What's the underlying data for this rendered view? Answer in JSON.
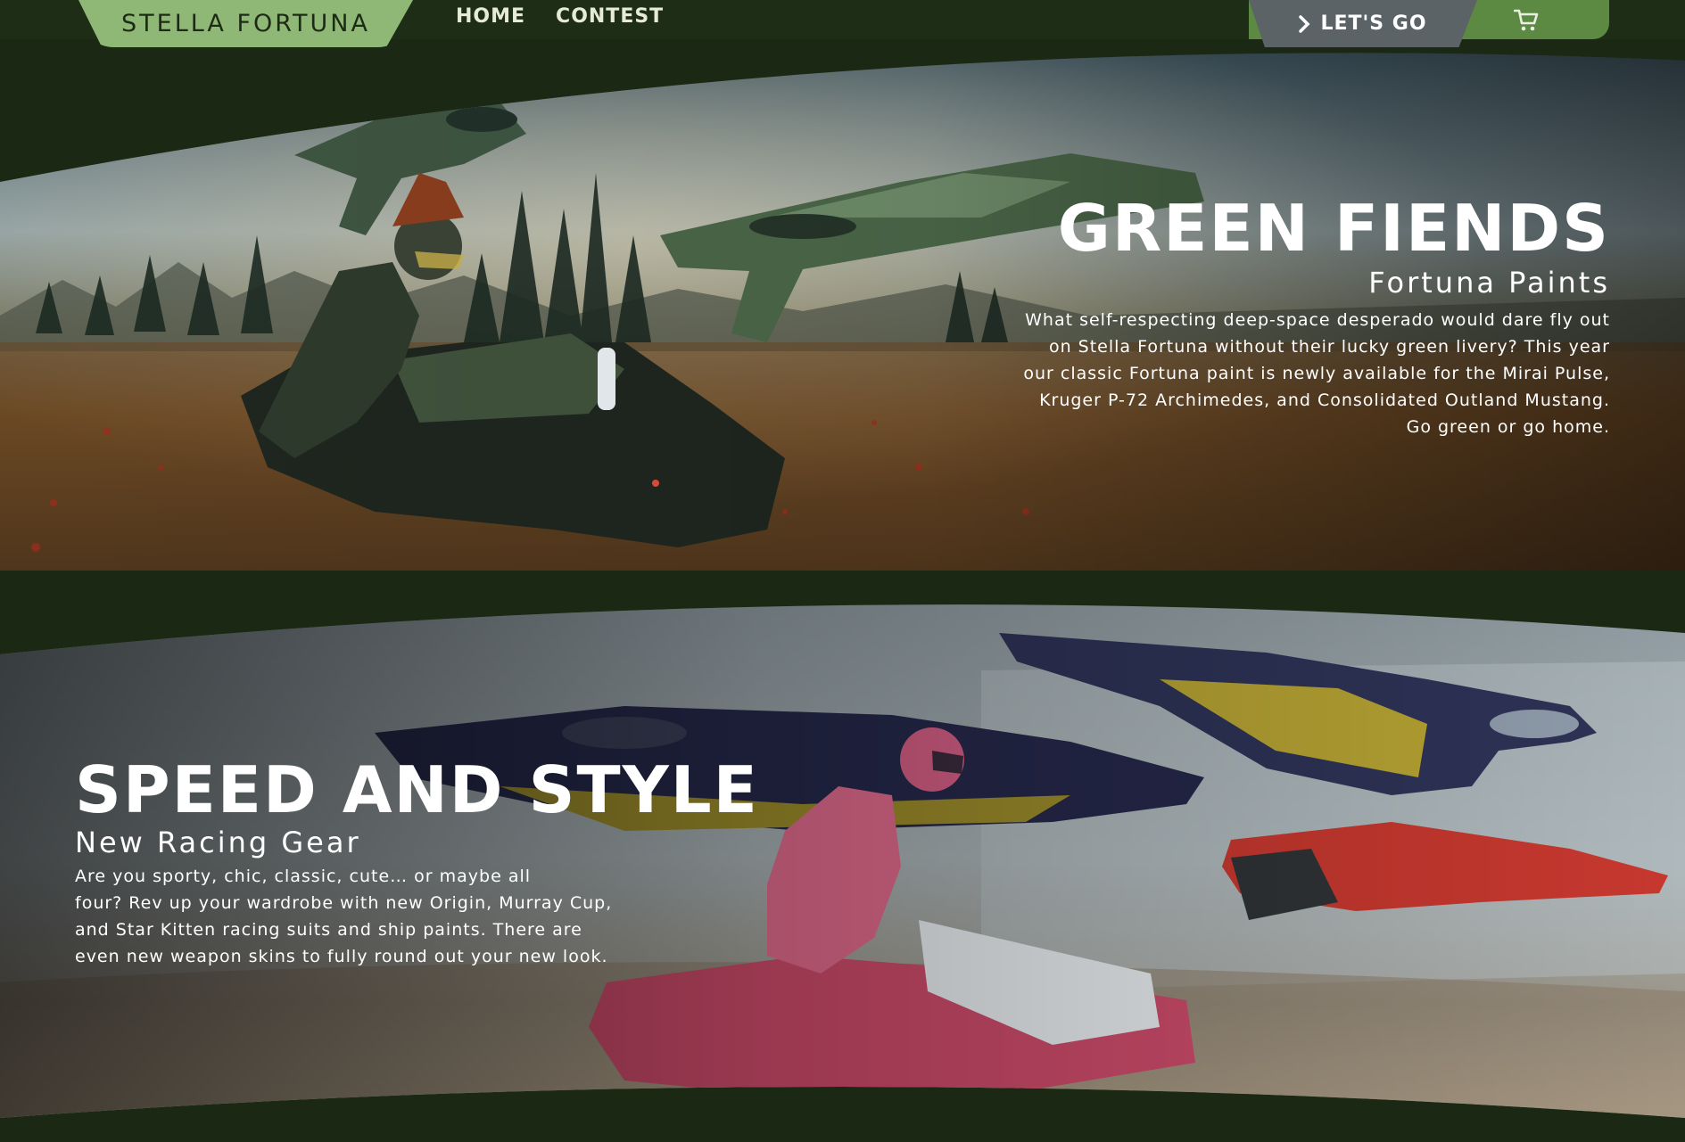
{
  "nav": {
    "brand": "STELLA FORTUNA",
    "links": [
      "HOME",
      "CONTEST"
    ],
    "cta_label": "LET'S GO",
    "cart_icon": "cart-icon"
  },
  "sections": [
    {
      "title": "GREEN FIENDS",
      "subtitle": "Fortuna Paints",
      "body_lines": [
        "What self-respecting deep-space desperado would dare fly out",
        "on Stella Fortuna without their lucky green livery? This year",
        "our classic Fortuna paint is newly available for the Mirai Pulse,",
        "Kruger P-72 Archimedes, and Consolidated Outland Mustang.",
        "Go green or go home."
      ]
    },
    {
      "title": "SPEED AND STYLE",
      "subtitle": "New Racing Gear",
      "body_lines": [
        "Are you sporty, chic, classic, cute… or maybe all",
        "four? Rev up your wardrobe with new Origin, Murray Cup,",
        "and Star Kitten racing suits and ship paints. There are",
        "even new weapon skins to fully round out your new look."
      ]
    }
  ],
  "colors": {
    "background": "#1a2814",
    "topbar": "#1e2d16",
    "brand_tab": "#8fb877",
    "brand_text": "#1d2b15",
    "cta_button": "#5b6366",
    "cart_tab": "#5c8a43"
  }
}
